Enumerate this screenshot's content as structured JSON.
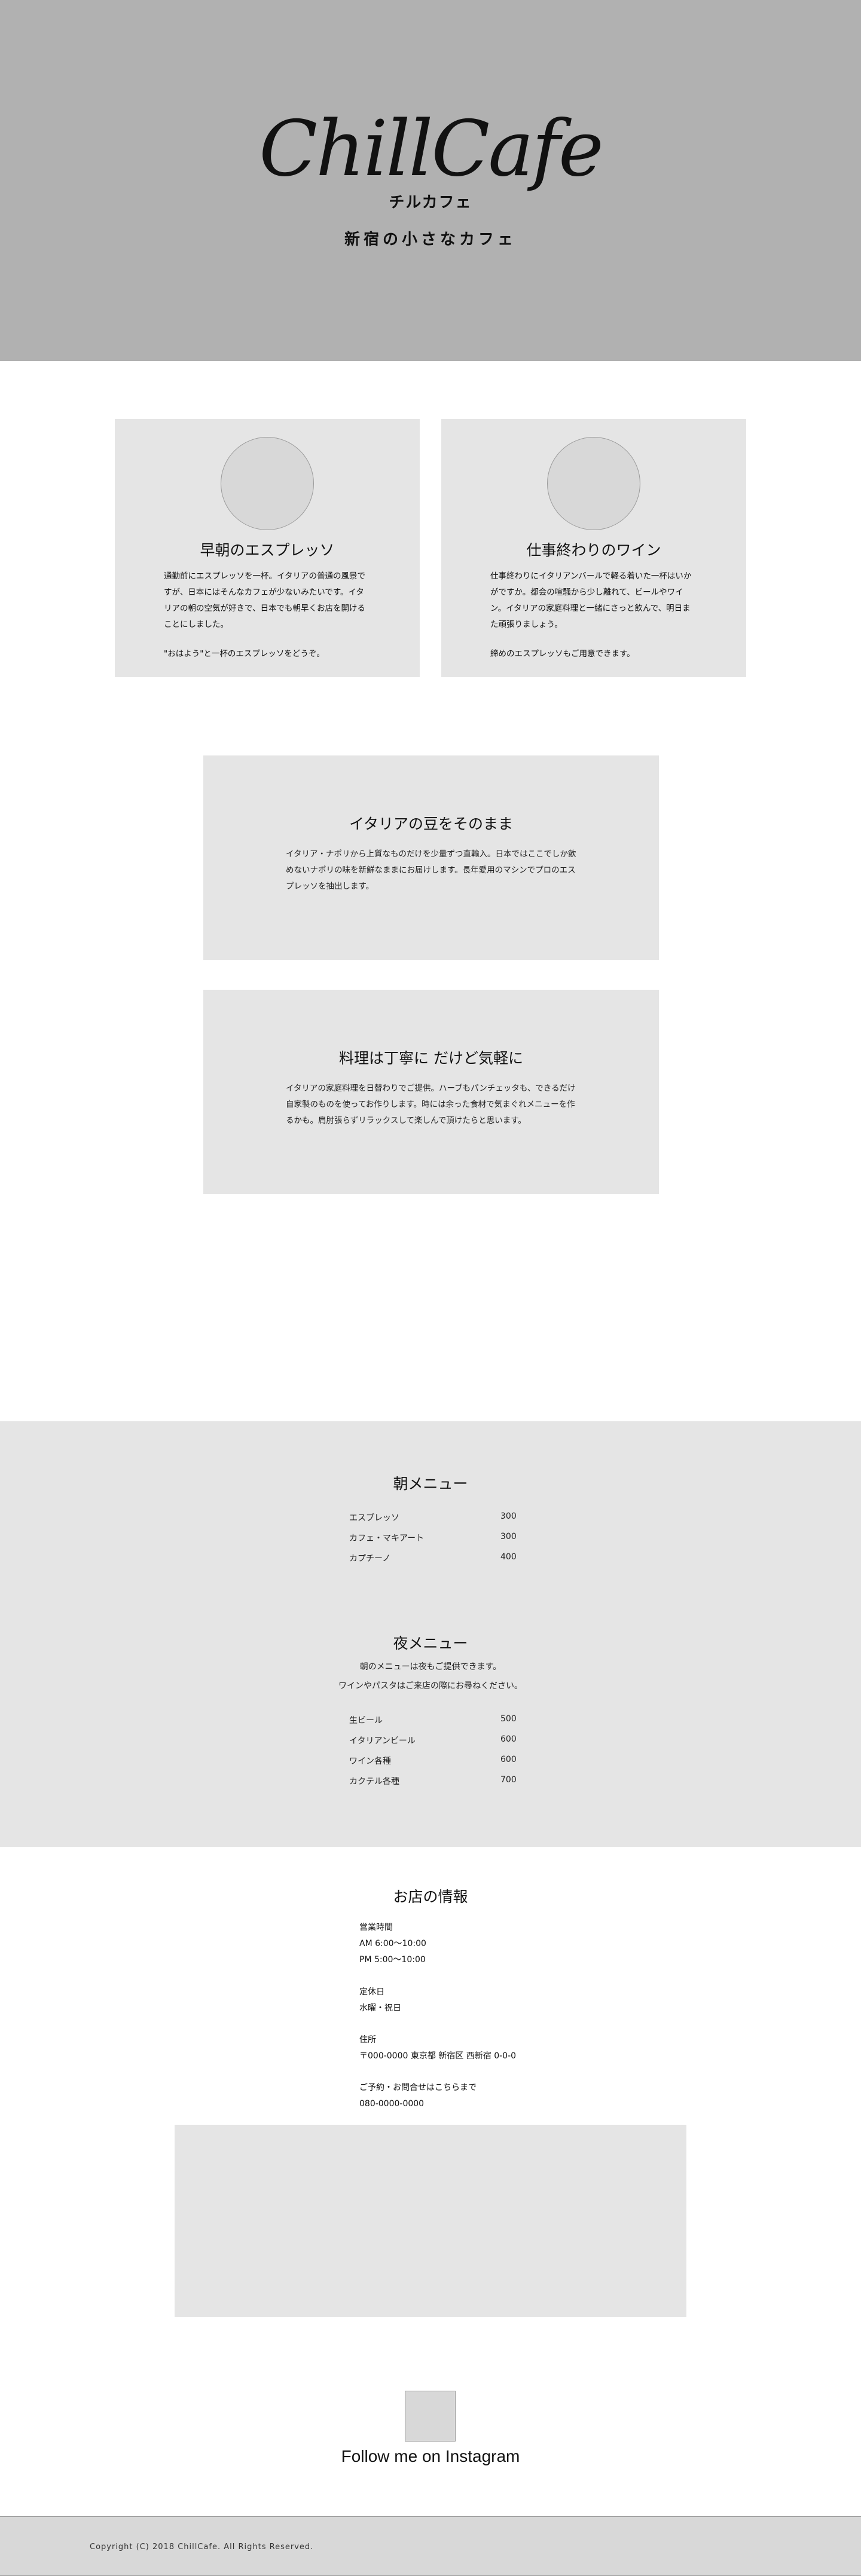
{
  "hero": {
    "logo": "ChillCafe",
    "subtitle": "チルカフェ",
    "tagline": "新宿の小さなカフェ"
  },
  "features": [
    {
      "title": "早朝のエスプレッソ",
      "body": "通勤前にエスプレッソを一杯。イタリアの普通の風景ですが、日本にはそんなカフェが少ないみたいです。イタリアの朝の空気が好きで、日本でも朝早くお店を開けることにしました。",
      "note": "\"おはよう\"と一杯のエスプレッソをどうぞ。"
    },
    {
      "title": "仕事終わりのワイン",
      "body": "仕事終わりにイタリアンバールで軽る着いた一杯はいかがですか。都会の喧騒から少し離れて、ビールやワイン。イタリアの家庭料理と一緒にさっと飲んで、明日また頑張りましょう。",
      "note": "締めのエスプレッソもご用意できます。"
    }
  ],
  "story": [
    {
      "title": "イタリアの豆をそのまま",
      "body": "イタリア・ナポリから上質なものだけを少量ずつ直輸入。日本ではここでしか飲めないナポリの味を新鮮なままにお届けします。長年愛用のマシンでプロのエスプレッソを抽出します。"
    },
    {
      "title": "料理は丁寧に だけど気軽に",
      "body": "イタリアの家庭料理を日替わりでご提供。ハーブもパンチェッタも、できるだけ自家製のものを使ってお作りします。時には余った食材で気まぐれメニューを作るかも。肩肘張らずリラックスして楽しんで頂けたらと思います。"
    }
  ],
  "menu": {
    "morning": {
      "title": "朝メニュー",
      "items": [
        {
          "name": "エスプレッソ",
          "price": "300"
        },
        {
          "name": "カフェ・マキアート",
          "price": "300"
        },
        {
          "name": "カプチーノ",
          "price": "400"
        }
      ]
    },
    "evening": {
      "title": "夜メニュー",
      "note1": "朝のメニューは夜もご提供できます。",
      "note2": "ワインやパスタはご来店の際にお尋ねください。",
      "items": [
        {
          "name": "生ビール",
          "price": "500"
        },
        {
          "name": "イタリアンビール",
          "price": "600"
        },
        {
          "name": "ワイン各種",
          "price": "600"
        },
        {
          "name": "カクテル各種",
          "price": "700"
        }
      ]
    }
  },
  "info": {
    "title": "お店の情報",
    "hours_label": "営業時間",
    "hours_morning": "AM 6:00〜10:00",
    "hours_evening": "PM 5:00〜10:00",
    "holiday_label": "定休日",
    "holiday_value": "水曜・祝日",
    "address_label": "住所",
    "address_value": "〒000-0000 東京都 新宿区 西新宿 0-0-0",
    "contact_label": "ご予約・お問合せはこちらまで",
    "contact_value": "080-0000-0000"
  },
  "instagram": {
    "label": "Follow me on Instagram"
  },
  "footer": {
    "copyright": "Copyright (C) 2018 ChillCafe. All Rights Reserved."
  }
}
